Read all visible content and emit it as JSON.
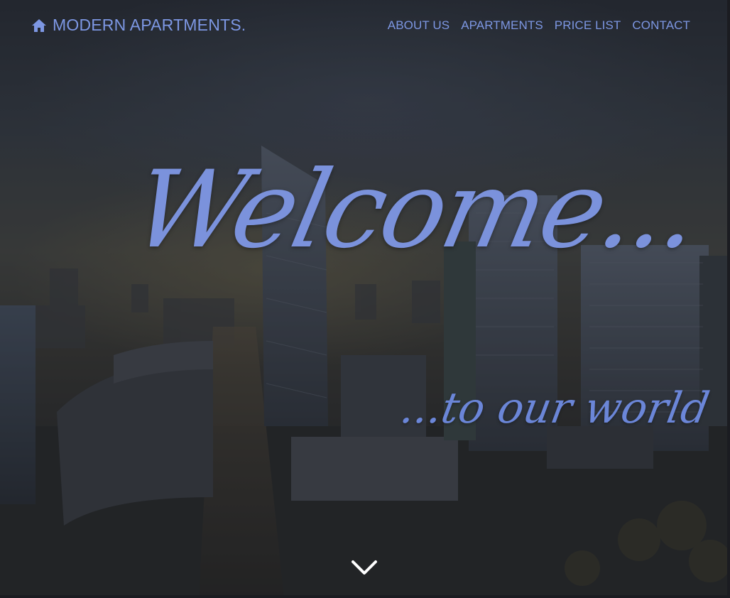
{
  "header": {
    "brand": {
      "icon": "home-icon",
      "label": "MODERN APARTMENTS."
    },
    "nav": [
      {
        "label": "ABOUT US"
      },
      {
        "label": "APARTMENTS"
      },
      {
        "label": "PRICE LIST"
      },
      {
        "label": "CONTACT"
      }
    ]
  },
  "hero": {
    "headline": "Welcome...",
    "tagline": "...to our world",
    "scroll_icon": "chevron-down-icon",
    "background_image": "city-skyline-photo"
  },
  "colors": {
    "accent": "#7d97e3",
    "headline": "#7b92dc",
    "scroll_icon": "#ffffff"
  }
}
